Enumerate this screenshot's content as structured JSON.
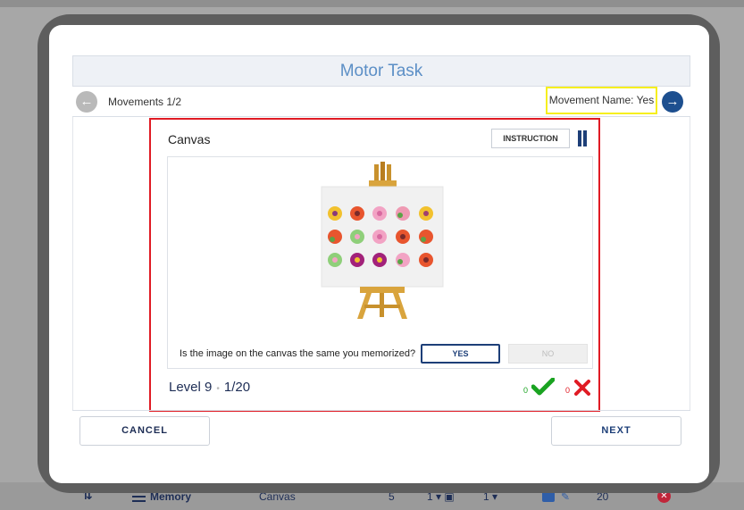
{
  "window": {
    "title": "Motor Task"
  },
  "navigation": {
    "movements_label": "Movements 1/2",
    "movement_name_label": "Movement Name: Yes"
  },
  "task": {
    "title": "Canvas",
    "instruction_label": "INSTRUCTION",
    "question": "Is the image on the canvas the same you memorized?",
    "yes_label": "YES",
    "no_label": "NO",
    "level_label": "Level 9",
    "progress_label": "1/20",
    "correct_count": "0",
    "wrong_count": "0",
    "colors": {
      "accent": "#1d3f78",
      "highlight_border": "#e01b24",
      "name_highlight": "#f6ef1e",
      "correct": "#1aa321",
      "wrong": "#e01b24"
    }
  },
  "footer": {
    "cancel_label": "CANCEL",
    "next_label": "NEXT"
  },
  "background_row": {
    "category": "Memory",
    "task": "Canvas",
    "count": "5",
    "select_a": "1",
    "select_b": "1",
    "limit": "20"
  },
  "icons": [
    "sort-icon",
    "list-icon",
    "back-arrow-icon",
    "forward-arrow-icon",
    "pause-icon",
    "easel-icon",
    "check-icon",
    "cross-icon",
    "wrench-icon",
    "delete-icon"
  ]
}
